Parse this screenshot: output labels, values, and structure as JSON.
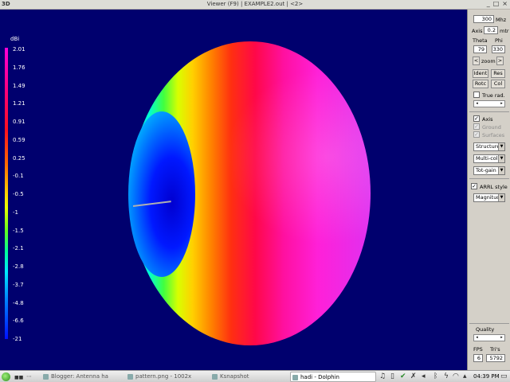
{
  "window": {
    "app_badge": "3D",
    "title": "Viewer (F9)    |  EXAMPLE2.out  | <2>",
    "buttons": [
      "_",
      "□",
      "×"
    ]
  },
  "legend": {
    "unit": "dBi",
    "labels": [
      "2.01",
      "1.76",
      "1.49",
      "1.21",
      "0.91",
      "0.59",
      "0.25",
      "-0.1",
      "-0.5",
      "-1",
      "-1.5",
      "-2.1",
      "-2.8",
      "-3.7",
      "-4.8",
      "-6.6",
      "-21"
    ],
    "colors": [
      "#ff00d8",
      "#ff0000",
      "#ffd200",
      "#00ff9a",
      "#00e8ff",
      "#0010ff"
    ]
  },
  "panel": {
    "freq_value": "300",
    "freq_unit": "Mhz",
    "axis_label": "Axis",
    "axis_value": "0.2",
    "axis_unit": "mtr",
    "theta_label": "Theta",
    "phi_label": "Phi",
    "theta_value": "79",
    "phi_value": "330",
    "zoom_left": "<",
    "zoom_label": "zoom",
    "zoom_right": ">",
    "buttons": {
      "ident": "Ident",
      "res": "Res",
      "rotc": "Rotc",
      "col": "Col"
    },
    "true_rad_label": "True rad.",
    "true_rad_checked": false,
    "checks": [
      {
        "label": "Axis",
        "checked": true,
        "enabled": true
      },
      {
        "label": "Ground",
        "checked": true,
        "enabled": false
      },
      {
        "label": "Surfaces",
        "checked": true,
        "enabled": false
      }
    ],
    "selects": [
      "Structure",
      "Multi-color",
      "Tot-gain"
    ],
    "arrl_label": "ARRL style",
    "arrl_checked": true,
    "arrl_select": "Magnitude",
    "quality_label": "Quality",
    "fps_label": "FPS",
    "tris_label": "Tri's",
    "fps_value": "6",
    "tris_value": "5792"
  },
  "taskbar": {
    "tasks": [
      {
        "label": "Blogger: Antenna ha",
        "active": false
      },
      {
        "label": "pattern.png - 1002x",
        "active": false
      },
      {
        "label": "Ksnapshot",
        "active": false
      },
      {
        "label": "hadi - Dolphin",
        "active": true
      }
    ],
    "clock": "04:39 PM"
  }
}
